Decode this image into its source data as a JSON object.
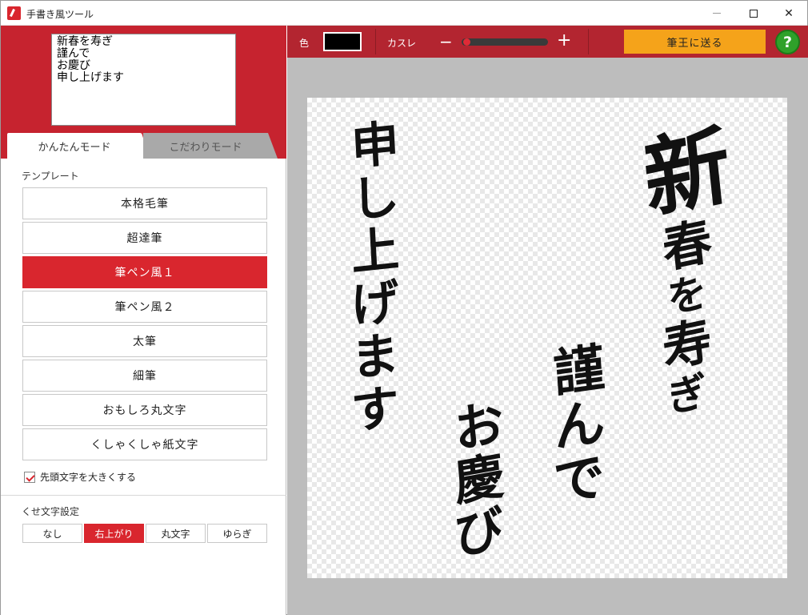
{
  "window": {
    "title": "手書き風ツール",
    "controls": {
      "minimize": "—",
      "maximize": "□",
      "close": "✕"
    }
  },
  "input_text": "新春を寿ぎ\n謹んで\nお慶び\n申し上げます",
  "tabs": {
    "easy": "かんたんモード",
    "detail": "こだわりモード",
    "active": "easy"
  },
  "template_section": {
    "label": "テンプレート",
    "items": [
      "本格毛筆",
      "超達筆",
      "筆ペン風１",
      "筆ペン風２",
      "太筆",
      "細筆",
      "おもしろ丸文字",
      "くしゃくしゃ紙文字"
    ],
    "selected_index": 2
  },
  "first_char_large": {
    "label": "先頭文字を大きくする",
    "checked": true
  },
  "kuse_section": {
    "label": "くせ文字設定",
    "options": [
      "なし",
      "右上がり",
      "丸文字",
      "ゆらぎ"
    ],
    "selected_index": 1
  },
  "toolbar": {
    "color_label": "色",
    "color_value": "#000000",
    "kasure_label": "カスレ",
    "kasure_minus": "−",
    "kasure_plus": "+",
    "kasure_level": 0.02,
    "send_label": "筆王に送る",
    "help_label": "?"
  },
  "colors": {
    "accent_red": "#c6232f",
    "toolbar_red": "#b32530",
    "send_orange": "#f5a31a",
    "help_green": "#2fa12a"
  },
  "canvas": {
    "columns": [
      "新春を寿ぎ",
      "謹んで",
      "お慶び",
      "申し上げます"
    ]
  }
}
